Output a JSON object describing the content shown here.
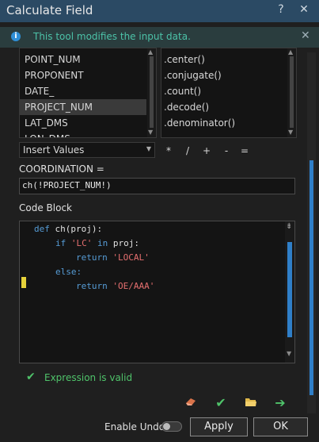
{
  "window": {
    "title": "Calculate Field",
    "help_icon": "?",
    "close_icon": "✕"
  },
  "info": {
    "message": "This tool modifies the input data."
  },
  "fields": [
    "POINT_NUM",
    "PROPONENT",
    "DATE_",
    "PROJECT_NUM",
    "LAT_DMS",
    "LON_DMS"
  ],
  "selected_field": "PROJECT_NUM",
  "functions": [
    ".center()",
    ".conjugate()",
    ".count()",
    ".decode()",
    ".denominator()"
  ],
  "insert_select": {
    "value": "Insert Values"
  },
  "operators": [
    "*",
    "/",
    "+",
    "-",
    "="
  ],
  "expression": {
    "label": "COORDINATION =",
    "value": "ch(!PROJECT_NUM!)"
  },
  "code_block": {
    "label": "Code Block",
    "lines": [
      {
        "indent": 0,
        "parts": [
          {
            "t": "def ",
            "c": "kw"
          },
          {
            "t": "ch(proj):",
            "c": "id"
          }
        ]
      },
      {
        "indent": 1,
        "parts": [
          {
            "t": "if ",
            "c": "kw"
          },
          {
            "t": "'LC'",
            "c": "str"
          },
          {
            "t": " in ",
            "c": "kw"
          },
          {
            "t": "proj:",
            "c": "id"
          }
        ]
      },
      {
        "indent": 2,
        "parts": [
          {
            "t": "return ",
            "c": "kw"
          },
          {
            "t": "'LOCAL'",
            "c": "str"
          }
        ]
      },
      {
        "indent": 1,
        "parts": [
          {
            "t": "else:",
            "c": "kw"
          }
        ]
      },
      {
        "indent": 2,
        "parts": [
          {
            "t": "return ",
            "c": "kw"
          },
          {
            "t": "'OE/AAA'",
            "c": "str"
          }
        ]
      }
    ]
  },
  "validation": {
    "message": "Expression is valid"
  },
  "toolbar_icons": [
    "eraser-icon",
    "check-icon",
    "folder-open-icon",
    "arrow-right-icon"
  ],
  "footer": {
    "undo_label": "Enable Undo",
    "undo_enabled": false,
    "apply_label": "Apply",
    "ok_label": "OK"
  },
  "colors": {
    "accent": "#2f7fc8",
    "title_bar": "#2b4a64",
    "valid": "#4fc36a",
    "info_text": "#4cc2a8"
  }
}
